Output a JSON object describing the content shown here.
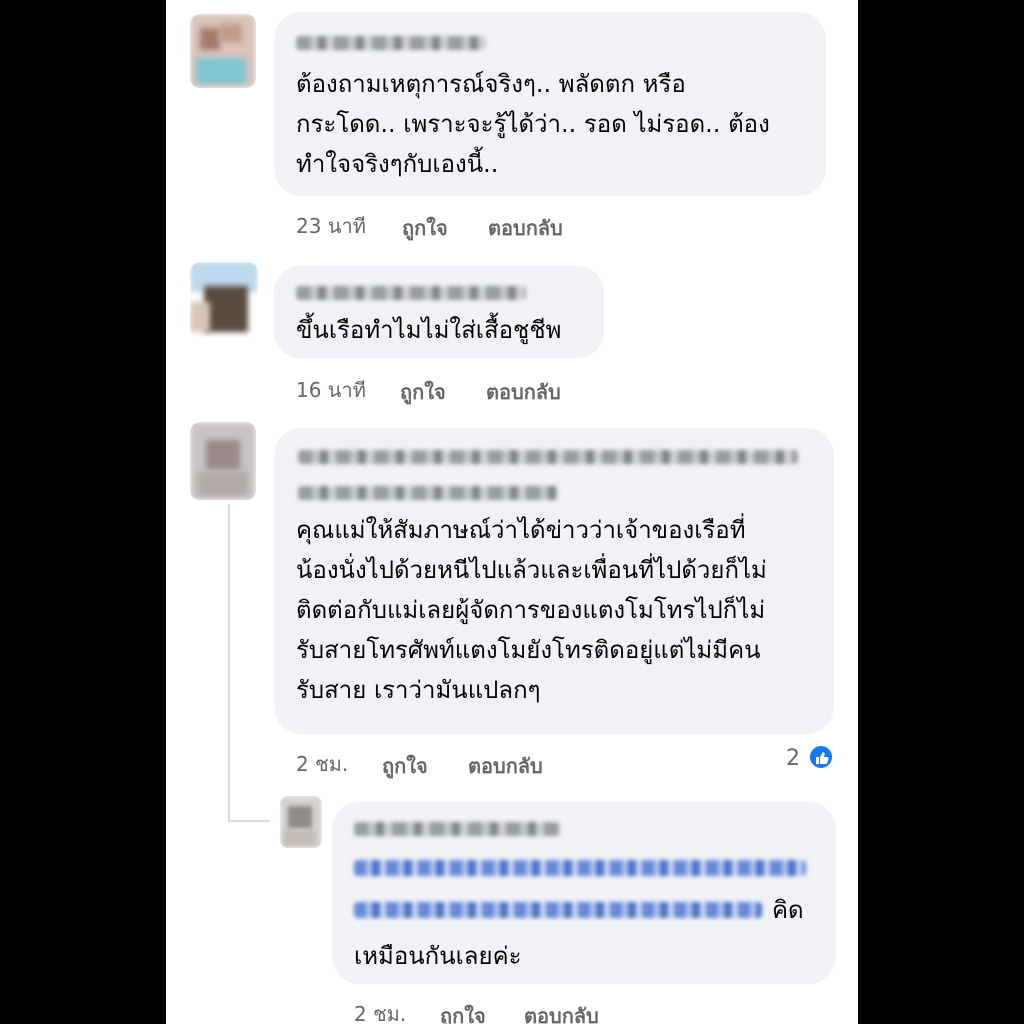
{
  "comments": [
    {
      "text": "ต้องถามเหตุการณ์จริงๆ.. พลัดตก หรือ\nกระโดด..  เพราะจะรู้ได้ว่า.. รอด ไม่รอด.. ต้อง\nทำใจจริงๆกับเองนี้..",
      "time": "23 นาที",
      "like_label": "ถูกใจ",
      "reply_label": "ตอบกลับ"
    },
    {
      "text": "ขึ้นเรือทำไมไม่ใส่เสื้อชูชีพ",
      "time": "16 นาที",
      "like_label": "ถูกใจ",
      "reply_label": "ตอบกลับ"
    },
    {
      "text": "คุณแม่ให้สัมภาษณ์ว่าได้ข่าวว่าเจ้าของเรือที่\nน้องนั่งไปด้วยหนีไปแล้วและเพื่อนที่ไปด้วยก็ไม่\nติดต่อกับแม่เลยผู้จัดการของแตงโมโทรไปก็ไม่\nรับสายโทรศัพท์แตงโมยังโทรติดอยู่แต่ไม่มีคน\nรับสาย  เราว่ามันแปลกๆ",
      "time": "2 ชม.",
      "like_label": "ถูกใจ",
      "reply_label": "ตอบกลับ",
      "reaction_count": "2",
      "reaction_color": "#1877f2"
    }
  ],
  "reply": {
    "text_tail": "คิด",
    "text_line2": "เหมือนกันเลยค่ะ",
    "time": "2 ชม.",
    "like_label": "ถูกใจ",
    "reply_label": "ตอบกลับ"
  },
  "icons": {
    "reaction": "like-thumbs-up-icon"
  },
  "colors": {
    "bubble": "#f0f2f5",
    "meta_text": "#65676b",
    "link": "#3f63c2"
  }
}
